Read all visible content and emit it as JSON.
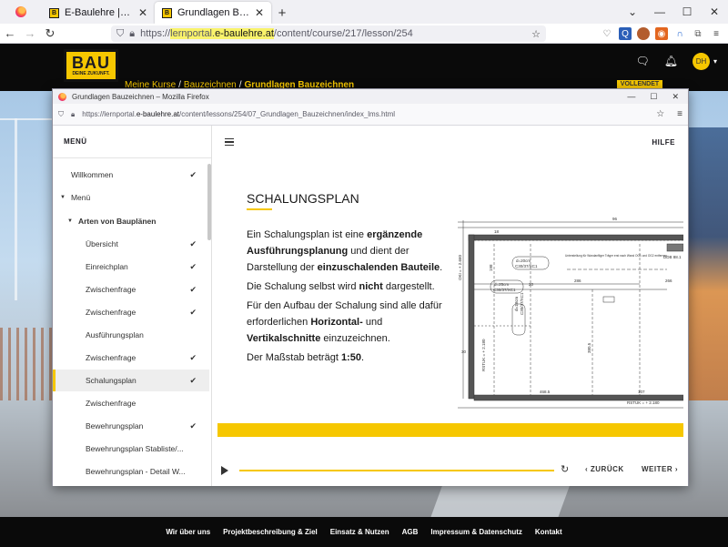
{
  "browser": {
    "tabs": [
      {
        "title": "E-Baulehre | Digitales Lernen an",
        "close": "✕"
      },
      {
        "title": "Grundlagen Bauzeichnen | Bau",
        "close": "✕"
      }
    ],
    "tab_favicon_letter": "B",
    "newtab": "+",
    "window_controls": [
      "⌄",
      "—",
      "☐",
      "✕"
    ],
    "url": {
      "scheme": "https://",
      "subdomain": "lernportal.",
      "domain": "e-baulehre.at",
      "path": "/content/course/217/lesson/254"
    }
  },
  "site": {
    "logo": {
      "big": "BAU",
      "small": "DEINE ZUKUNFT."
    },
    "breadcrumbs": [
      "Meine Kurse",
      "Bauzeichnen",
      "Grundlagen Bauzeichnen"
    ],
    "avatar_initials": "DH",
    "progress_label": "VOLLENDET",
    "footer_links": [
      "Wir über uns",
      "Projektbeschreibung & Ziel",
      "Einsatz & Nutzen",
      "AGB",
      "Impressum & Datenschutz",
      "Kontakt"
    ]
  },
  "popup": {
    "title": "Grundlagen Bauzeichnen – Mozilla Firefox",
    "url_scheme": "https://",
    "url_sub": "lernportal.",
    "url_domain": "e-baulehre.at",
    "url_path": "/content/lessons/254/07_Grundlagen_Bauzeichnen/index_lms.html"
  },
  "lms": {
    "menu_header": "MENÜ",
    "help": "HILFE",
    "menu": [
      {
        "label": "Willkommen",
        "checked": true,
        "level": 0
      },
      {
        "label": "Menü",
        "checked": false,
        "level": 0,
        "caret": true
      },
      {
        "label": "Arten von Bauplänen",
        "checked": false,
        "level": 1,
        "caret": true,
        "bold": true
      },
      {
        "label": "Übersicht",
        "checked": true,
        "level": 2
      },
      {
        "label": "Einreichplan",
        "checked": true,
        "level": 2
      },
      {
        "label": "Zwischenfrage",
        "checked": true,
        "level": 2
      },
      {
        "label": "Zwischenfrage",
        "checked": true,
        "level": 2
      },
      {
        "label": "Ausführungsplan",
        "checked": false,
        "level": 2
      },
      {
        "label": "Zwischenfrage",
        "checked": true,
        "level": 2
      },
      {
        "label": "Schalungsplan",
        "checked": true,
        "level": 2,
        "active": true
      },
      {
        "label": "Zwischenfrage",
        "checked": false,
        "level": 2
      },
      {
        "label": "Bewehrungsplan",
        "checked": true,
        "level": 2
      },
      {
        "label": "Bewehrungsplan Stabliste/...",
        "checked": false,
        "level": 2
      },
      {
        "label": "Bewehrungsplan - Detail W...",
        "checked": false,
        "level": 2
      }
    ],
    "lesson": {
      "title": "SCHALUNGSPLAN",
      "p1": [
        {
          "t": "Ein Schalungsplan ist eine ",
          "b": false
        },
        {
          "t": "ergänzende Ausführungsplanung",
          "b": true
        },
        {
          "t": " und dient der Darstellung der ",
          "b": false
        },
        {
          "t": "einzuschalenden Bauteile",
          "b": true
        },
        {
          "t": ".",
          "b": false
        }
      ],
      "p2": [
        {
          "t": "Die Schalung selbst wird ",
          "b": false
        },
        {
          "t": "nicht",
          "b": true
        },
        {
          "t": " dargestellt.",
          "b": false
        }
      ],
      "p3": [
        {
          "t": "Für den Aufbau der Schalung sind alle dafür erforderlichen ",
          "b": false
        },
        {
          "t": "Horizontal-",
          "b": true
        },
        {
          "t": " und ",
          "b": false
        },
        {
          "t": "Vertikalschnitte",
          "b": true
        },
        {
          "t": " einzuzeichnen.",
          "b": false
        }
      ],
      "p4": [
        {
          "t": "Der Maßstab beträgt ",
          "b": false
        },
        {
          "t": "1:50",
          "b": true
        },
        {
          "t": ".",
          "b": false
        }
      ]
    },
    "plan_labels": {
      "d1": "d=20cm",
      "c1": "C30/37/XC1",
      "d2": "d=25cm",
      "c2": "C30/37/XC1",
      "d3": "d=18cm",
      "c3": "C30/37/XC1",
      "note": "Unterstellung für Wandanfliger Träger erst nach Wand OG1 und OG2 entfernen.",
      "ddb": "DDB 88.1",
      "rstuk1": "RSTUK = + 2.180",
      "rstuk2": "RSTUK = + 2.180",
      "ok": "OKI = + 2.660",
      "dims": [
        "18",
        "96",
        "20",
        "286",
        "266",
        "198",
        "380.5",
        "468.5",
        "107",
        "30"
      ]
    },
    "player": {
      "back": "ZURÜCK",
      "next": "WEITER",
      "progress": 1.0
    }
  },
  "colors": {
    "brand": "#f6c700",
    "dark": "#0a0a0a"
  }
}
